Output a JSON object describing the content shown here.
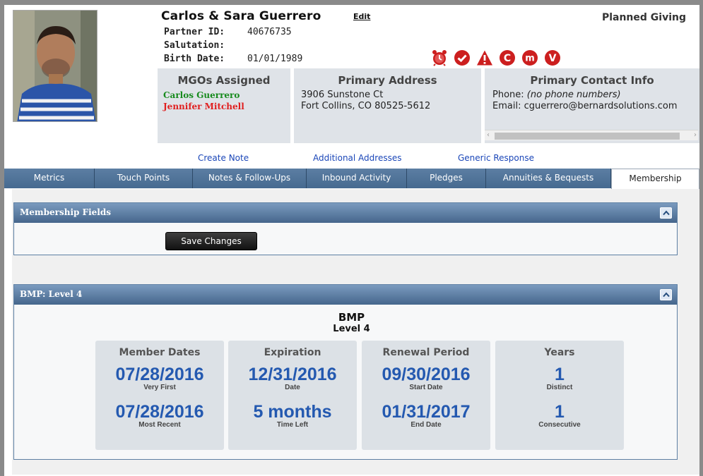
{
  "header": {
    "name": "Carlos & Sara Guerrero",
    "edit_label": "Edit",
    "category": "Planned Giving",
    "partner_id_label": "Partner ID:",
    "partner_id": "40676735",
    "salutation_label": "Salutation:",
    "salutation": "",
    "birth_date_label": "Birth Date:",
    "birth_date": "01/01/1989"
  },
  "status_icons": [
    "alarm-clock-icon",
    "check-circle-icon",
    "warning-triangle-icon",
    "c-circle-icon",
    "m-circle-icon",
    "v-circle-icon"
  ],
  "status_icon_letters": [
    "C",
    "m",
    "V"
  ],
  "panels": {
    "mgos": {
      "title": "MGOs Assigned",
      "items": [
        "Carlos Guerrero",
        "Jennifer Mitchell"
      ]
    },
    "address": {
      "title": "Primary Address",
      "line1": "3906 Sunstone Ct",
      "line2": "Fort Collins, CO 80525-5612"
    },
    "contact": {
      "title": "Primary Contact Info",
      "phone_label": "Phone:",
      "phone_value": "(no phone numbers)",
      "email_label": "Email:",
      "email_value": "cguerrero@bernardsolutions.com"
    }
  },
  "actions": [
    "Create Note",
    "Additional Addresses",
    "Generic Response"
  ],
  "tabs": [
    "Metrics",
    "Touch Points",
    "Notes & Follow-Ups",
    "Inbound Activity",
    "Pledges",
    "Annuities & Bequests",
    "Membership"
  ],
  "active_tab": "Membership",
  "membership_fields": {
    "title": "Membership Fields",
    "save_label": "Save Changes"
  },
  "bmp": {
    "header": "BMP:  Level 4",
    "title": "BMP",
    "subtitle": "Level 4",
    "cards": [
      {
        "title": "Member Dates",
        "v1": "07/28/2016",
        "c1": "Very First",
        "v2": "07/28/2016",
        "c2": "Most Recent"
      },
      {
        "title": "Expiration",
        "v1": "12/31/2016",
        "c1": "Date",
        "v2": "5 months",
        "c2": "Time Left"
      },
      {
        "title": "Renewal Period",
        "v1": "09/30/2016",
        "c1": "Start Date",
        "v2": "01/31/2017",
        "c2": "End Date"
      },
      {
        "title": "Years",
        "v1": "1",
        "c1": "Distinct",
        "v2": "1",
        "c2": "Consecutive"
      }
    ]
  },
  "colors": {
    "tab_bar": "#4d6f92",
    "link": "#1a46b8",
    "value_blue": "#2459b0",
    "icon_red": "#cc1f1f",
    "mgo_green": "#168a1c",
    "mgo_red": "#e01f1f"
  }
}
